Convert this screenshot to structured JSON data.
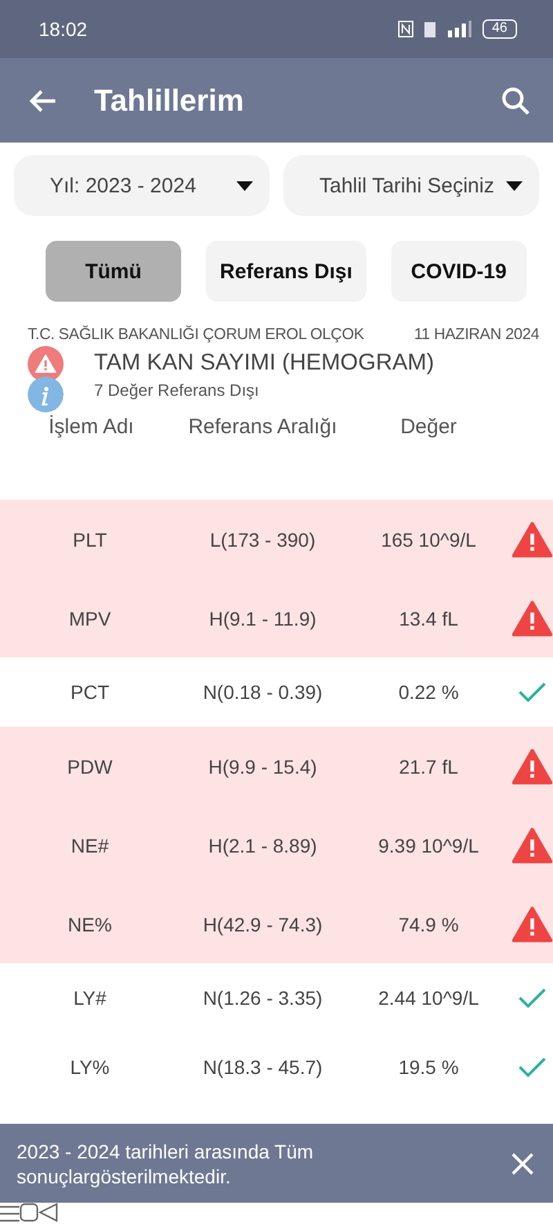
{
  "status_bar": {
    "time": "18:02",
    "battery": "46"
  },
  "app_bar": {
    "title": "Tahlillerim"
  },
  "filters": [
    {
      "label": "Yıl: 2023 - 2024"
    },
    {
      "label": "Tahlil Tarihi Seçiniz"
    }
  ],
  "tabs": [
    {
      "label": "Tümü",
      "selected": true
    },
    {
      "label": "Referans Dışı",
      "selected": false
    },
    {
      "label": "COVID-19",
      "selected": false
    }
  ],
  "result": {
    "institution": "T.C. SAĞLIK BAKANLIĞI ÇORUM EROL OLÇOK",
    "date": "11 HAZIRAN 2024",
    "test_name": "TAM KAN SAYIMI (HEMOGRAM)",
    "summary": "7 Değer Referans Dışı"
  },
  "table": {
    "columns": [
      "İşlem Adı",
      "Referans Aralığı",
      "Değer"
    ],
    "rows": [
      {
        "name": "PLT",
        "range": "L(173 - 390)",
        "value": "165 10^9/L",
        "out_of_range": true
      },
      {
        "name": "MPV",
        "range": "H(9.1 - 11.9)",
        "value": "13.4 fL",
        "out_of_range": true
      },
      {
        "name": "PCT",
        "range": "N(0.18 - 0.39)",
        "value": "0.22 %",
        "out_of_range": false
      },
      {
        "name": "PDW",
        "range": "H(9.9 - 15.4)",
        "value": "21.7 fL",
        "out_of_range": true
      },
      {
        "name": "NE#",
        "range": "H(2.1 - 8.89)",
        "value": "9.39 10^9/L",
        "out_of_range": true
      },
      {
        "name": "NE%",
        "range": "H(42.9 - 74.3)",
        "value": "74.9 %",
        "out_of_range": true
      },
      {
        "name": "LY#",
        "range": "N(1.26 - 3.35)",
        "value": "2.44 10^9/L",
        "out_of_range": false
      },
      {
        "name": "LY%",
        "range": "N(18.3 - 45.7)",
        "value": "19.5 %",
        "out_of_range": false
      }
    ]
  },
  "snackbar": {
    "message": "2023 - 2024 tarihleri arasında Tüm sonuçlargösterilmektedir."
  }
}
